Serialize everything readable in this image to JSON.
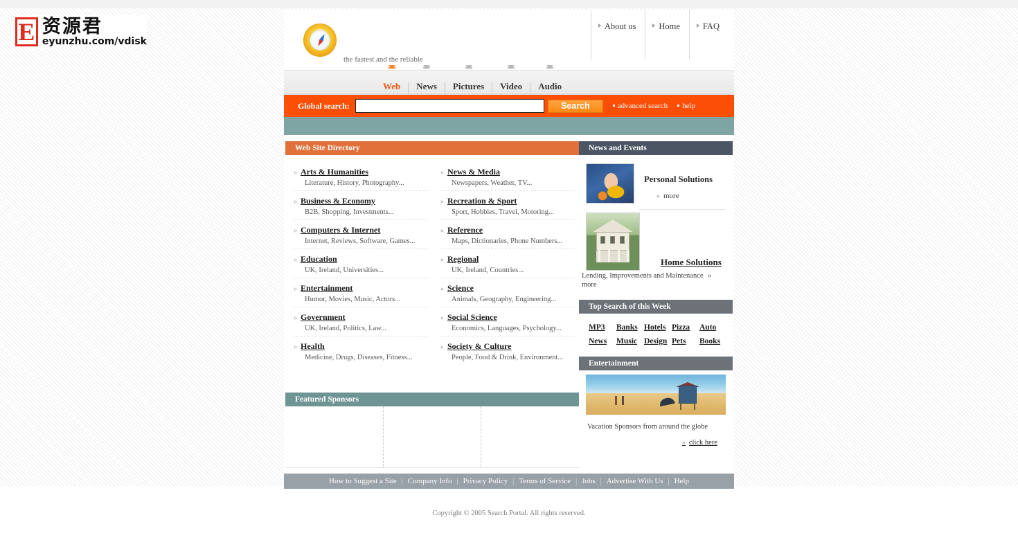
{
  "brand": {
    "letter": "E",
    "chinese": "资源君",
    "url": "eyunzhu.com/vdisk"
  },
  "header": {
    "tagline": "the fastest and the reliable",
    "logo_icon": "compass-icon",
    "nav": [
      {
        "label": "About us"
      },
      {
        "label": "Home"
      },
      {
        "label": "FAQ"
      }
    ]
  },
  "tabs": [
    {
      "label": "Web",
      "active": true
    },
    {
      "label": "News",
      "active": false
    },
    {
      "label": "Pictures",
      "active": false
    },
    {
      "label": "Video",
      "active": false
    },
    {
      "label": "Audio",
      "active": false
    }
  ],
  "search": {
    "label": "Global search:",
    "value": "",
    "placeholder": "",
    "button": "Search",
    "advanced": "advanced search",
    "help": "help"
  },
  "directory": {
    "title": "Web Site Directory",
    "left": [
      {
        "title": "Arts & Humanities",
        "sub": "Literature, History, Photography..."
      },
      {
        "title": "Business & Economy",
        "sub": "B2B, Shopping, Investments..."
      },
      {
        "title": "Computers & Internet",
        "sub": "Internet, Reviews, Software, Games..."
      },
      {
        "title": "Education",
        "sub": "UK, Ireland, Universities..."
      },
      {
        "title": "Entertainment",
        "sub": "Humor, Movies, Music, Actors..."
      },
      {
        "title": "Government",
        "sub": "UK, Ireland, Politics, Law..."
      },
      {
        "title": "Health",
        "sub": "Medicine, Drugs, Diseases, Fitness..."
      }
    ],
    "right": [
      {
        "title": "News & Media",
        "sub": "Newspapers, Weather, TV..."
      },
      {
        "title": "Recreation & Sport",
        "sub": "Sport, Hobbies, Travel, Motoring..."
      },
      {
        "title": "Reference",
        "sub": "Maps, Dictionaries, Phone Numbers..."
      },
      {
        "title": "Regional",
        "sub": "UK, Ireland, Countries..."
      },
      {
        "title": "Science",
        "sub": "Animals, Geography, Engineering..."
      },
      {
        "title": "Social Science",
        "sub": "Economics, Languages, Psychology..."
      },
      {
        "title": "Society & Culture",
        "sub": "People, Food & Drink, Environment..."
      }
    ]
  },
  "sponsors": {
    "title": "Featured Sponsors"
  },
  "news": {
    "title": "News and Events",
    "item1": {
      "title": "Personal Solutions",
      "more": "more",
      "image": "child-in-raincoat-photo"
    },
    "item2": {
      "title": "Home Solutions",
      "desc": "Lending, Improvements and Maintenance",
      "more": "more",
      "image": "colonial-house-photo"
    }
  },
  "topsearch": {
    "title": "Top Search of this Week",
    "items": [
      "MP3",
      "Banks",
      "Hotels",
      "Pizza",
      "Auto",
      "News",
      "Music",
      "Design",
      "Pets",
      "Books"
    ]
  },
  "entertainment": {
    "title": "Entertainment",
    "image": "beach-lifeguard-tower-photo",
    "caption": "Vacation Sponsors from around the globe",
    "cta": "click here"
  },
  "footer": {
    "links": [
      "How to Suggest a Site",
      "Company Info",
      "Privacy Policy",
      "Terms of Service",
      "Jobs",
      "Advertise With Us",
      "Help"
    ],
    "copyright": "Copyright © 2005 Search Portal. All rights reserved."
  },
  "colors": {
    "accent_orange": "#fb4e07",
    "tab_active": "#e8560f",
    "directory_header": "#e1703a",
    "news_header": "#4c5564",
    "topsearch_header": "#6d7278",
    "teal_band": "#7ea4a3",
    "footer_bar": "#98a0a8"
  }
}
